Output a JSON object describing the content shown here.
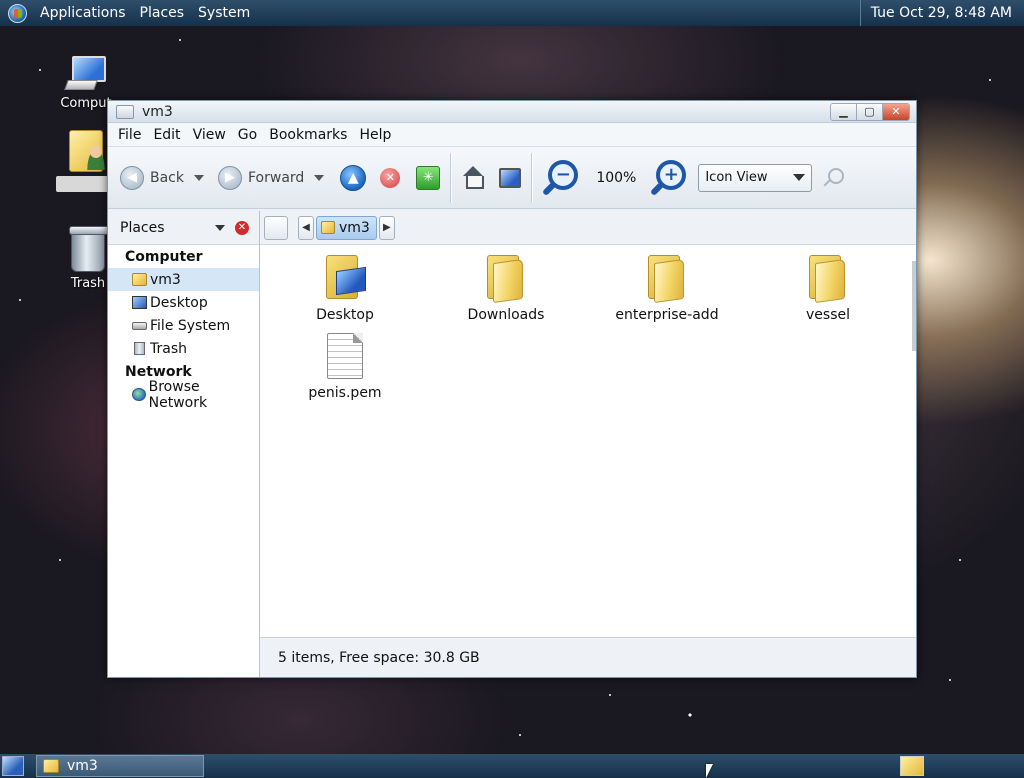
{
  "top_panel": {
    "menus": [
      "Applications",
      "Places",
      "System"
    ],
    "clock": "Tue Oct 29,  8:48 AM"
  },
  "desktop_icons": {
    "computer": "Comput",
    "trash": "Trash"
  },
  "window": {
    "title": "vm3",
    "menubar": [
      "File",
      "Edit",
      "View",
      "Go",
      "Bookmarks",
      "Help"
    ],
    "toolbar": {
      "back": "Back",
      "forward": "Forward",
      "zoom_level": "100%",
      "view_mode": "Icon View"
    },
    "sidebar": {
      "header": "Places",
      "group_computer": "Computer",
      "items_computer": [
        "vm3",
        "Desktop",
        "File System",
        "Trash"
      ],
      "group_network": "Network",
      "items_network": [
        "Browse Network"
      ]
    },
    "pathbar": {
      "current": "vm3"
    },
    "files": [
      "Desktop",
      "Downloads",
      "enterprise-add",
      "vessel",
      "penis.pem"
    ],
    "status": "5 items, Free space: 30.8 GB"
  },
  "taskbar": {
    "task": "vm3"
  }
}
